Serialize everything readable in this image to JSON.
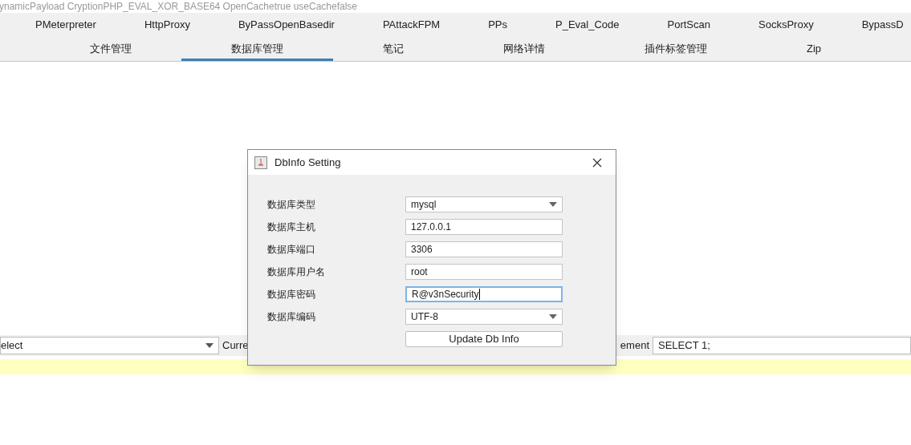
{
  "header_text": "ynamicPayload CryptionPHP_EVAL_XOR_BASE64 OpenCachetrue useCachefalse",
  "tabs_row_1": [
    {
      "label": "PMeterpreter",
      "selected": false
    },
    {
      "label": "HttpProxy",
      "selected": false
    },
    {
      "label": "ByPassOpenBasedir",
      "selected": false
    },
    {
      "label": "PAttackFPM",
      "selected": false
    },
    {
      "label": "PPs",
      "selected": false
    },
    {
      "label": "P_Eval_Code",
      "selected": false
    },
    {
      "label": "PortScan",
      "selected": false
    },
    {
      "label": "SocksProxy",
      "selected": false
    },
    {
      "label": "BypassD",
      "selected": false
    }
  ],
  "tabs_row_2": [
    {
      "label": "文件管理",
      "selected": false
    },
    {
      "label": "数据库管理",
      "selected": true
    },
    {
      "label": "笔记",
      "selected": false
    },
    {
      "label": "网络详情",
      "selected": false
    },
    {
      "label": "插件标签管理",
      "selected": false
    },
    {
      "label": "Zip",
      "selected": false
    }
  ],
  "toolbar": {
    "select_value": "elect",
    "label_left": "Curre",
    "label_right": "ement",
    "statement_value": "SELECT 1;"
  },
  "dialog": {
    "title": "DbInfo Setting",
    "fields": [
      {
        "label": "数据库类型",
        "kind": "select",
        "value": "mysql",
        "focused": false
      },
      {
        "label": "数据库主机",
        "kind": "text",
        "value": "127.0.0.1",
        "focused": false
      },
      {
        "label": "数据库端口",
        "kind": "text",
        "value": "3306",
        "focused": false
      },
      {
        "label": "数据库用户名",
        "kind": "text",
        "value": "root",
        "focused": false
      },
      {
        "label": "数据库密码",
        "kind": "text",
        "value": "R@v3nSecurity",
        "focused": true
      },
      {
        "label": "数据库编码",
        "kind": "select",
        "value": "UTF-8",
        "focused": false
      }
    ],
    "button": "Update Db Info"
  }
}
